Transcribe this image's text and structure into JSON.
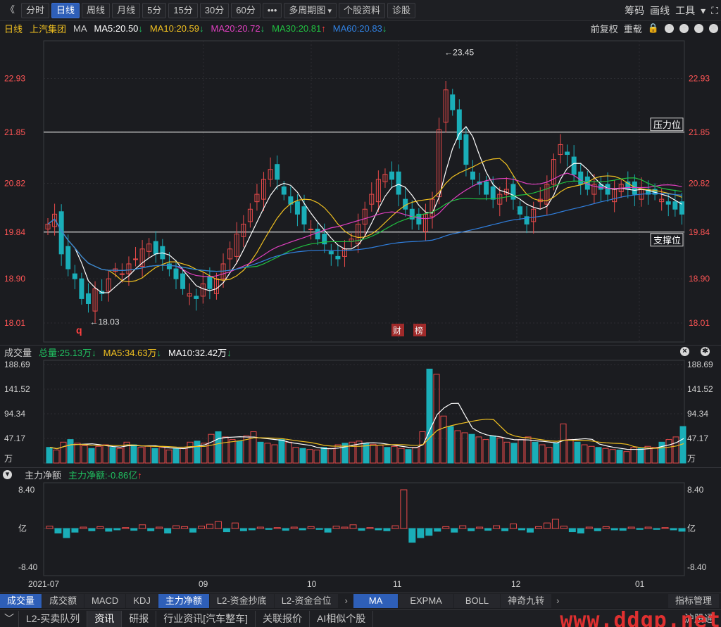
{
  "toolbar": {
    "back": "《",
    "tabs": [
      "分时",
      "日线",
      "周线",
      "月线",
      "5分",
      "15分",
      "30分",
      "60分",
      "•••",
      "多周期图",
      "个股资料",
      "诊股"
    ],
    "active": 1,
    "right": [
      "筹码",
      "画线",
      "工具"
    ]
  },
  "info": {
    "period": "日线",
    "name": "上汽集团",
    "ind": "MA",
    "ma5": "MA5:20.50",
    "ma10": "MA10:20.59",
    "ma20": "MA20:20.72",
    "ma30": "MA30:20.81",
    "ma60": "MA60:20.83",
    "right": [
      "前复权",
      "重载"
    ]
  },
  "colors": {
    "up": "#e84a4a",
    "down": "#1aaeb8",
    "ma5": "#ffffff",
    "ma10": "#f0c020",
    "ma20": "#e040c0",
    "ma30": "#20c040",
    "ma60": "#3080e0",
    "axis": "#ff5555"
  },
  "main_axis": {
    "labels": [
      "22.93",
      "21.85",
      "20.82",
      "19.84",
      "18.90",
      "18.01"
    ]
  },
  "annotations": {
    "high": "23.45",
    "low": "18.03",
    "q": "q",
    "cai": "财",
    "bang": "榜",
    "resistance": "压力位",
    "support": "支撑位"
  },
  "volume": {
    "title": "成交量",
    "total": "总量:25.13万",
    "ma5": "MA5:34.63万",
    "ma10": "MA10:32.42万",
    "labels": [
      "188.69",
      "141.52",
      "94.34",
      "47.17",
      "万"
    ]
  },
  "fund": {
    "title": "主力净额",
    "value": "主力净额:-0.86亿",
    "labels": [
      "8.40",
      "亿",
      "-8.40"
    ]
  },
  "dates": [
    "2021-07",
    "09",
    "10",
    "11",
    "12",
    "01"
  ],
  "bottom_tabs": {
    "left": [
      "成交量",
      "成交额",
      "MACD",
      "KDJ",
      "主力净额",
      "L2-资金抄底",
      "L2-资金合位"
    ],
    "mid": [
      "MA",
      "EXPMA",
      "BOLL",
      "神奇九转"
    ],
    "right": "指标管理"
  },
  "status_tabs": [
    "L2-买卖队列",
    "资讯",
    "研报",
    "行业资讯[汽车整车]",
    "关联报价",
    "AI相似个股",
    "沪股通"
  ],
  "watermark": "www.ddgp.net",
  "chart_data": {
    "type": "candlestick",
    "ylim": [
      17.6,
      23.8
    ],
    "closes": [
      20.0,
      20.2,
      19.4,
      19.1,
      18.9,
      18.5,
      18.4,
      18.7,
      18.6,
      18.9,
      19.1,
      19.0,
      19.2,
      19.3,
      19.5,
      19.6,
      19.4,
      19.3,
      19.1,
      18.9,
      18.7,
      18.6,
      18.5,
      18.8,
      18.7,
      18.9,
      19.2,
      19.5,
      19.8,
      20.0,
      20.3,
      20.6,
      20.9,
      21.1,
      20.9,
      20.6,
      20.4,
      20.2,
      20.0,
      19.9,
      19.7,
      19.6,
      19.4,
      19.3,
      19.5,
      19.7,
      20.0,
      20.3,
      20.6,
      20.9,
      21.0,
      20.9,
      20.6,
      20.3,
      20.1,
      20.0,
      20.2,
      20.5,
      21.9,
      22.7,
      22.3,
      21.7,
      21.2,
      20.9,
      20.8,
      20.6,
      20.5,
      20.6,
      20.7,
      20.5,
      20.2,
      20.0,
      20.3,
      20.5,
      20.8,
      21.3,
      21.6,
      21.4,
      21.0,
      20.8,
      20.7,
      20.8,
      20.7,
      20.6,
      20.7,
      20.8,
      20.7,
      20.6,
      20.7,
      20.6,
      20.6,
      20.5,
      20.4,
      20.3,
      20.2
    ],
    "volumes": [
      30,
      25,
      40,
      45,
      38,
      33,
      28,
      32,
      35,
      30,
      28,
      40,
      35,
      30,
      32,
      28,
      30,
      25,
      27,
      28,
      40,
      42,
      38,
      55,
      60,
      50,
      45,
      42,
      52,
      60,
      40,
      38,
      35,
      45,
      40,
      30,
      28,
      26,
      25,
      30,
      28,
      35,
      38,
      40,
      42,
      38,
      36,
      34,
      30,
      32,
      28,
      26,
      30,
      60,
      180,
      170,
      90,
      70,
      62,
      58,
      55,
      50,
      45,
      52,
      48,
      40,
      38,
      45,
      50,
      40,
      35,
      30,
      38,
      75,
      45,
      40,
      35,
      32,
      30,
      28,
      26,
      25,
      22,
      30,
      28,
      32,
      30,
      40,
      45,
      50,
      70
    ],
    "fund_net": [
      0.5,
      -1.0,
      -2.0,
      -0.8,
      0.3,
      -0.5,
      0.4,
      -0.6,
      -0.3,
      0.2,
      -0.4,
      0.8,
      -0.5,
      0.3,
      -1.0,
      0.6,
      0.4,
      -0.8,
      0.5,
      0.9,
      1.5,
      -0.7,
      1.2,
      -0.5,
      -0.3,
      0.3,
      -0.2,
      0.2,
      -0.4,
      0.3,
      -0.3,
      0.4,
      -0.2,
      -0.8,
      0.5,
      0.3,
      0.8,
      -0.4,
      0.2,
      -0.3,
      -0.5,
      0.6,
      8.4,
      -3.0,
      -2.0,
      -1.5,
      -0.6,
      0.4,
      -0.8,
      0.6,
      -0.5,
      0.3,
      -0.4,
      0.6,
      -0.5,
      1.0,
      -0.3,
      -0.8,
      0.4,
      1.2,
      2.0,
      0.5,
      -0.7,
      -1.0,
      0.3,
      -0.5,
      0.4,
      -0.3,
      -0.4,
      0.3,
      -0.2,
      0.3,
      -0.2,
      0.2,
      -0.3,
      -0.6
    ]
  }
}
